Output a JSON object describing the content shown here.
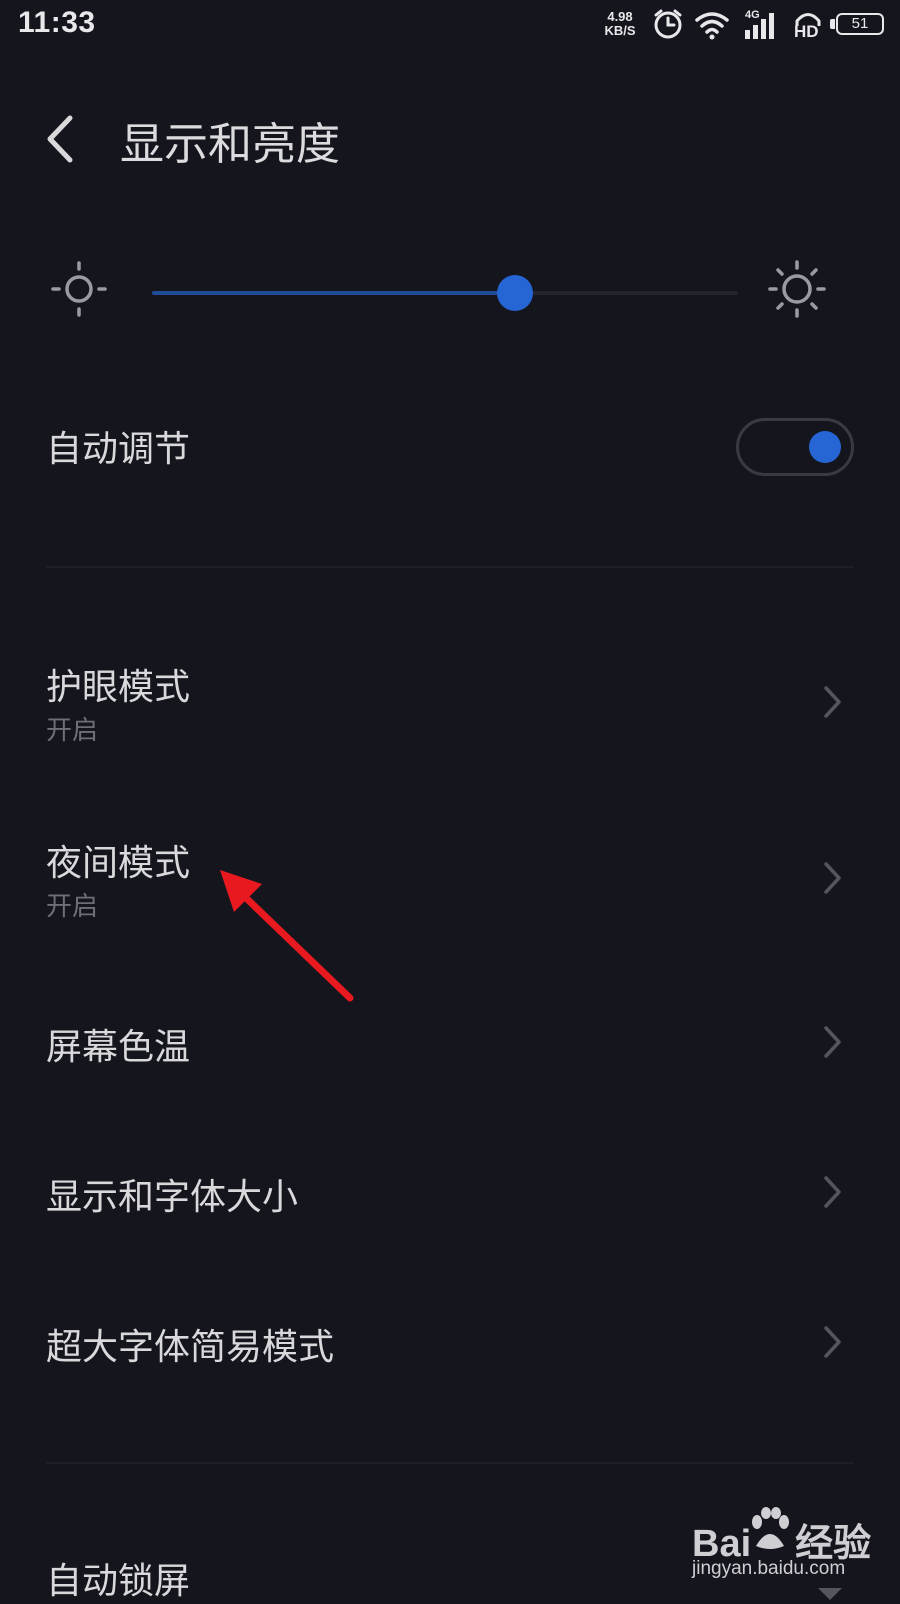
{
  "status_bar": {
    "time": "11:33",
    "network_speed": "4.98",
    "network_speed_unit": "KB/S",
    "network_type": "4G",
    "hd_label": "HD",
    "battery": "51",
    "icons": [
      "alarm-icon",
      "wifi-icon",
      "signal-icon",
      "hd-icon",
      "battery-icon"
    ]
  },
  "header": {
    "title": "显示和亮度",
    "back_icon": "back-arrow-icon"
  },
  "brightness": {
    "level": 0.62,
    "min_icon": "sun-small-icon",
    "max_icon": "sun-large-icon"
  },
  "auto_adjust": {
    "label": "自动调节",
    "enabled": true
  },
  "items": [
    {
      "label": "护眼模式",
      "value": "开启"
    },
    {
      "label": "夜间模式",
      "value": "开启"
    },
    {
      "label": "屏幕色温"
    },
    {
      "label": "显示和字体大小"
    },
    {
      "label": "超大字体简易模式"
    },
    {
      "label": "自动锁屏"
    }
  ],
  "annotation": {
    "type": "red-arrow",
    "target": "夜间模式",
    "color": "#e8191f"
  },
  "watermark": {
    "brand": "Bai",
    "brand_suffix": "经验",
    "url": "jingyan.baidu.com"
  },
  "colors": {
    "background": "#15161d",
    "accent": "#2565d4",
    "text": "#d9d9dc",
    "subtext": "#6e6f76"
  }
}
